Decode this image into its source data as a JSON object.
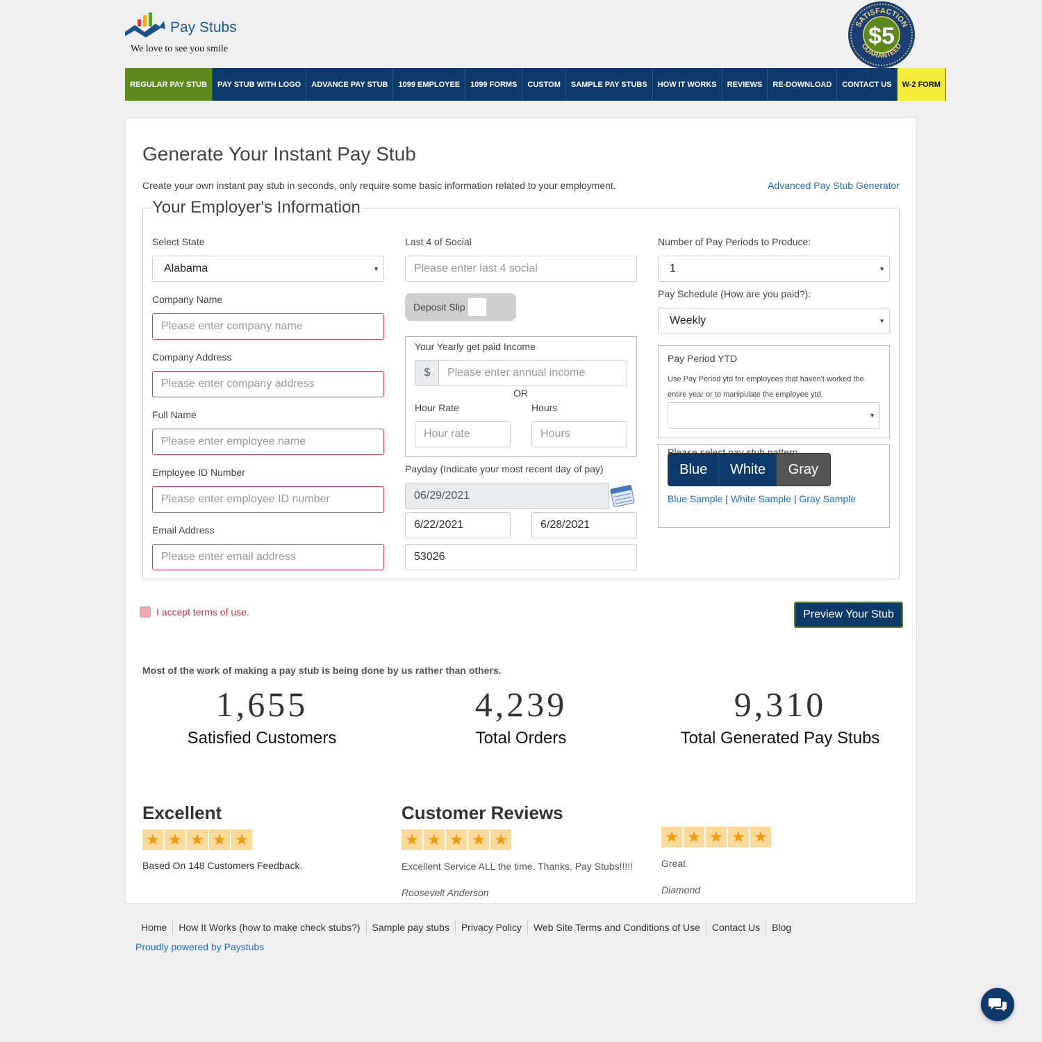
{
  "header": {
    "brand": "Pay Stubs",
    "tagline": "We love to see you smile",
    "seal_top": "SATISFACTION",
    "seal_bottom": "GUARANTEED",
    "seal_price": "$5"
  },
  "nav": [
    {
      "label": "REGULAR PAY STUB",
      "active": true
    },
    {
      "label": "PAY STUB WITH LOGO"
    },
    {
      "label": "ADVANCE PAY STUB"
    },
    {
      "label": "1099 EMPLOYEE"
    },
    {
      "label": "1099 FORMS"
    },
    {
      "label": "CUSTOM"
    },
    {
      "label": "SAMPLE PAY STUBS"
    },
    {
      "label": "HOW IT WORKS"
    },
    {
      "label": "REVIEWS"
    },
    {
      "label": "RE-DOWNLOAD"
    },
    {
      "label": "CONTACT US"
    },
    {
      "label": "W-2 FORM"
    }
  ],
  "page": {
    "title": "Generate Your Instant Pay Stub",
    "intro": "Create your own instant pay stub in seconds, only require some basic information related to your employment.",
    "advanced_link": "Advanced Pay Stub Generator"
  },
  "form": {
    "legend": "Your Employer's Information",
    "state": {
      "label": "Select State",
      "value": "Alabama"
    },
    "company_name": {
      "label": "Company Name",
      "placeholder": "Please enter company name"
    },
    "company_address": {
      "label": "Company Address",
      "placeholder": "Please enter company address"
    },
    "full_name": {
      "label": "Full Name",
      "placeholder": "Please enter employee name"
    },
    "employee_id": {
      "label": "Employee ID Number",
      "placeholder": "Please enter employee ID number"
    },
    "email": {
      "label": "Email Address",
      "placeholder": "Please enter email address"
    },
    "social": {
      "label": "Last 4 of Social",
      "placeholder": "Please enter last 4 social"
    },
    "deposit_slip": "Deposit Slip",
    "income": {
      "title": "Your Yearly get paid Income",
      "currency": "$",
      "placeholder": "Please enter annual income",
      "or": "OR",
      "hour_rate_label": "Hour Rate",
      "hour_rate_placeholder": "Hour rate",
      "hours_label": "Hours",
      "hours_placeholder": "Hours"
    },
    "payday": {
      "label": "Payday (Indicate your most recent day of pay)",
      "value": "06/29/2021",
      "start": "6/22/2021",
      "end": "6/28/2021",
      "check_no": "53026"
    },
    "pay_periods": {
      "label": "Number of Pay Periods to Produce:",
      "value": "1"
    },
    "pay_schedule": {
      "label": "Pay Schedule (How are you paid?):",
      "value": "Weekly"
    },
    "ytd": {
      "title": "Pay Period YTD",
      "note": "Use Pay Period ytd for employees that haven't worked the entire year or to manipulate the employee ytd.",
      "value": ""
    },
    "pattern": {
      "title": "Please select pay stub pattern",
      "options": [
        "Blue",
        "White",
        "Gray"
      ],
      "samples": [
        "Blue Sample",
        "White Sample",
        "Gray Sample"
      ],
      "separator": "|"
    },
    "terms": "I accept terms of use.",
    "preview_button": "Preview Your Stub"
  },
  "stats": {
    "heading": "Most of the work of making a pay stub is being done by us rather than others.",
    "items": [
      {
        "value": "1,655",
        "caption": "Satisfied Customers"
      },
      {
        "value": "4,239",
        "caption": "Total Orders"
      },
      {
        "value": "9,310",
        "caption": "Total Generated Pay Stubs"
      }
    ]
  },
  "reviews": {
    "summary": {
      "title": "Excellent",
      "rating": 5,
      "text": "Based On 148 Customers Feedback."
    },
    "title": "Customer Reviews",
    "items": [
      {
        "rating": 5,
        "text": "Excellent Service ALL the time. Thanks, Pay Stubs!!!!!",
        "author": "Roosevelt Anderson"
      },
      {
        "rating": 5,
        "text": "Great",
        "author": "Diamond"
      }
    ]
  },
  "footer": {
    "links": [
      "Home",
      "How It Works (how to make check stubs?)",
      "Sample pay stubs",
      "Privacy Policy",
      "Web Site Terms and Conditions of Use",
      "Contact Us",
      "Blog"
    ],
    "powered": "Proudly powered by Paystubs"
  },
  "colors": {
    "navy": "#0d3a6a",
    "green": "#5c8a1c",
    "yellow": "#f4ec3a",
    "link": "#1e6fc2",
    "required": "#d04058"
  }
}
